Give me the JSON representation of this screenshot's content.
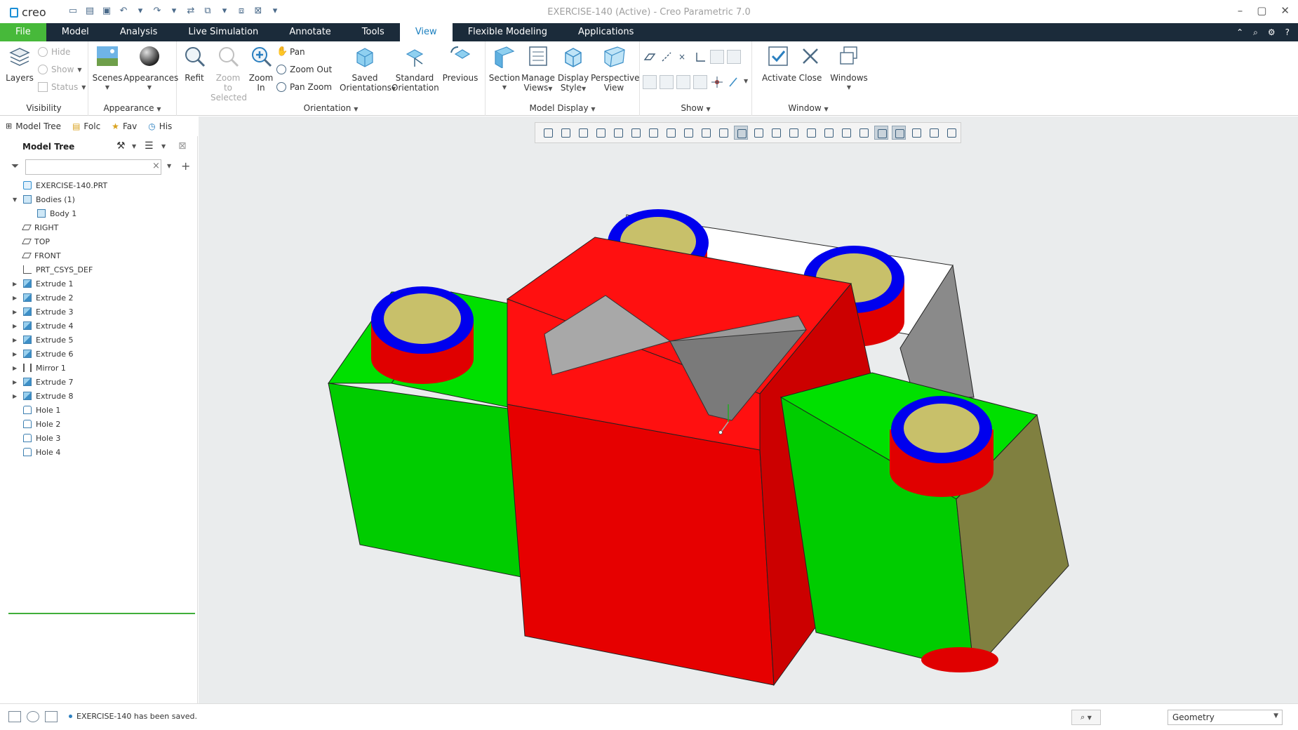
{
  "app": {
    "title": "EXERCISE-140 (Active) - Creo Parametric 7.0",
    "logo": "creo"
  },
  "tabs": [
    {
      "label": "File"
    },
    {
      "label": "Model"
    },
    {
      "label": "Analysis"
    },
    {
      "label": "Live Simulation"
    },
    {
      "label": "Annotate"
    },
    {
      "label": "Tools"
    },
    {
      "label": "View"
    },
    {
      "label": "Flexible Modeling"
    },
    {
      "label": "Applications"
    }
  ],
  "ribbon": {
    "visibility": {
      "label": "Visibility",
      "layers": "Layers",
      "hide": "Hide",
      "show": "Show",
      "status": "Status"
    },
    "appearance": {
      "label": "Appearance",
      "scenes": "Scenes",
      "appearances": "Appearances"
    },
    "orientation": {
      "label": "Orientation",
      "refit": "Refit",
      "zoom_selected_1": "Zoom to",
      "zoom_selected_2": "Selected",
      "zoom_in_1": "Zoom",
      "zoom_in_2": "In",
      "pan": "Pan",
      "zoom_out": "Zoom Out",
      "pan_zoom": "Pan Zoom",
      "saved_1": "Saved",
      "saved_2": "Orientations",
      "standard_1": "Standard",
      "standard_2": "Orientation",
      "previous": "Previous"
    },
    "model_display": {
      "label": "Model Display",
      "section": "Section",
      "manage_1": "Manage",
      "manage_2": "Views",
      "display_1": "Display",
      "display_2": "Style",
      "persp_1": "Perspective",
      "persp_2": "View"
    },
    "show": {
      "label": "Show"
    },
    "window": {
      "label": "Window",
      "activate": "Activate",
      "close": "Close",
      "windows": "Windows"
    }
  },
  "navigator": {
    "tabs": [
      {
        "label": "Model Tree"
      },
      {
        "label": "Folc"
      },
      {
        "label": "Fav"
      },
      {
        "label": "His"
      }
    ],
    "panel_title": "Model Tree"
  },
  "tree": [
    {
      "label": "EXERCISE-140.PRT",
      "icon": "part-icon",
      "level": 0,
      "expand": ""
    },
    {
      "label": "Bodies (1)",
      "icon": "bodies-icon",
      "level": 0,
      "expand": "▼"
    },
    {
      "label": "Body 1",
      "icon": "body-icon",
      "level": 1,
      "expand": ""
    },
    {
      "label": "RIGHT",
      "icon": "datum-plane-icon",
      "level": 0,
      "expand": ""
    },
    {
      "label": "TOP",
      "icon": "datum-plane-icon",
      "level": 0,
      "expand": ""
    },
    {
      "label": "FRONT",
      "icon": "datum-plane-icon",
      "level": 0,
      "expand": ""
    },
    {
      "label": "PRT_CSYS_DEF",
      "icon": "csys-icon",
      "level": 0,
      "expand": ""
    },
    {
      "label": "Extrude 1",
      "icon": "extrude-icon",
      "level": 0,
      "expand": "▶"
    },
    {
      "label": "Extrude 2",
      "icon": "extrude-icon",
      "level": 0,
      "expand": "▶"
    },
    {
      "label": "Extrude 3",
      "icon": "extrude-icon",
      "level": 0,
      "expand": "▶"
    },
    {
      "label": "Extrude 4",
      "icon": "extrude-icon",
      "level": 0,
      "expand": "▶"
    },
    {
      "label": "Extrude 5",
      "icon": "extrude-icon",
      "level": 0,
      "expand": "▶"
    },
    {
      "label": "Extrude 6",
      "icon": "extrude-icon",
      "level": 0,
      "expand": "▶"
    },
    {
      "label": "Mirror 1",
      "icon": "mirror-icon",
      "level": 0,
      "expand": "▶"
    },
    {
      "label": "Extrude 7",
      "icon": "extrude-icon",
      "level": 0,
      "expand": "▶"
    },
    {
      "label": "Extrude 8",
      "icon": "extrude-icon",
      "level": 0,
      "expand": "▶"
    },
    {
      "label": "Hole 1",
      "icon": "hole-icon",
      "level": 0,
      "expand": ""
    },
    {
      "label": "Hole 2",
      "icon": "hole-icon",
      "level": 0,
      "expand": ""
    },
    {
      "label": "Hole 3",
      "icon": "hole-icon",
      "level": 0,
      "expand": ""
    },
    {
      "label": "Hole 4",
      "icon": "hole-icon",
      "level": 0,
      "expand": ""
    }
  ],
  "status": {
    "message": "EXERCISE-140 has been saved.",
    "selection_filter": "Geometry"
  },
  "colors": {
    "ribbon_tab_bar": "#1b2b3a",
    "file_tab": "#47b93a",
    "active_tab_text": "#1a7fbf",
    "model_red": "#ff0000",
    "model_green": "#00dd00",
    "model_blue": "#0000ff",
    "hole_yellow": "#d8d27a"
  }
}
